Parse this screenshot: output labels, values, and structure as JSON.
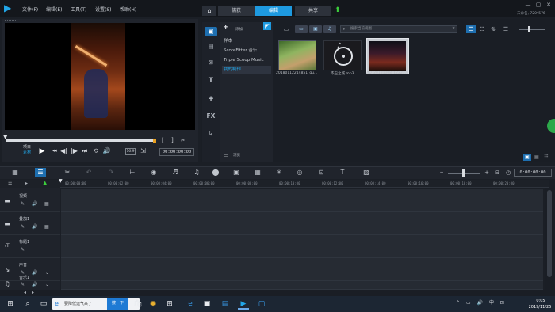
{
  "menu": [
    "文件(F)",
    "编辑(E)",
    "工具(T)",
    "设置(S)",
    "帮助(H)"
  ],
  "tabs": {
    "capture": "捕获",
    "edit": "编辑",
    "share": "共享"
  },
  "project_info": "未命名, 720*576",
  "preview": {
    "mode_project": "项目",
    "mode_clip": "素材",
    "ratio": "16:9",
    "timecode": "00:00:00:00"
  },
  "library": {
    "add_label": "添加",
    "folders": [
      "样本",
      "ScoreFitter 音乐",
      "Triple Scoop Music",
      "我的制作"
    ],
    "browse_label": "浏览",
    "search_placeholder": "搜索当前视图",
    "media": [
      {
        "name": "20180112214851_gu..."
      },
      {
        "name": "不应之城.mp3"
      },
      {
        "name": "VID_20181008_1222..."
      }
    ]
  },
  "timeline": {
    "timecode": "0:00:00:00",
    "ruler_labels": [
      "00:00:00:00",
      "00:00:02:00",
      "00:00:04:00",
      "00:00:06:00",
      "00:00:08:00",
      "00:00:10:00",
      "00:00:12:00",
      "00:00:14:00",
      "00:00:16:00",
      "00:00:18:00",
      "00:00:20:00"
    ],
    "tracks": [
      {
        "name": "视频",
        "icon": "video-track-icon"
      },
      {
        "name": "叠加1",
        "icon": "overlay-track-icon"
      },
      {
        "name": "标题1",
        "icon": "title-track-icon"
      },
      {
        "name": "声音",
        "icon": "voice-track-icon"
      },
      {
        "name": "音乐1",
        "icon": "music-track-icon"
      }
    ]
  },
  "taskbar": {
    "search_text": "要降低运气来了",
    "search_button": "搜一下",
    "ime": "中",
    "time": "0:05",
    "date": "2019/11/25"
  }
}
